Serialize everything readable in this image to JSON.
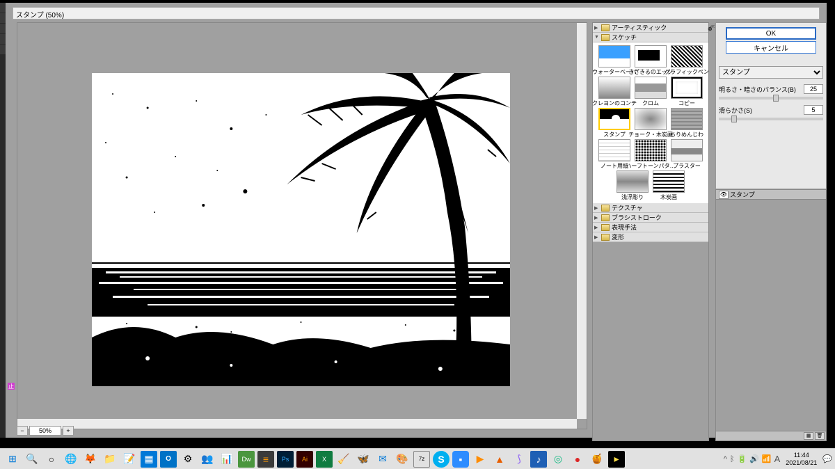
{
  "dialog": {
    "title": "スタンプ (50%)"
  },
  "zoom": {
    "minus": "−",
    "plus": "+",
    "value": "50%"
  },
  "buttons": {
    "ok": "OK",
    "cancel": "キャンセル"
  },
  "filter_select": "スタンプ",
  "sliders": {
    "balance": {
      "label": "明るさ・暗さのバランス(B)",
      "value": "25",
      "pos": 52
    },
    "smooth": {
      "label": "滑らかさ(S)",
      "value": "5",
      "pos": 12
    }
  },
  "categories": {
    "artistic": "アーティスティック",
    "sketch": "スケッチ",
    "texture": "テクスチャ",
    "brush": "ブラシストローク",
    "express": "表現手法",
    "distort": "変形"
  },
  "thumbs": [
    {
      "label": "ウォーターベーパ",
      "cls": "t-sky"
    },
    {
      "label": "きざきるのエッジ",
      "cls": "t-bw1"
    },
    {
      "label": "グラフィックペン",
      "cls": "t-lines"
    },
    {
      "label": "クレヨンのコンテ",
      "cls": "t-grad"
    },
    {
      "label": "クロム",
      "cls": "t-wave"
    },
    {
      "label": "コピー",
      "cls": "t-edge"
    },
    {
      "label": "スタンプ",
      "cls": "t-stamp",
      "selected": true
    },
    {
      "label": "チョーク・木炭画",
      "cls": "t-chalk"
    },
    {
      "label": "ちりめんじわ",
      "cls": "t-wrinkle"
    },
    {
      "label": "ノート用紙",
      "cls": "t-note"
    },
    {
      "label": "ハーフトーンパタ…",
      "cls": "t-half"
    },
    {
      "label": "プラスター",
      "cls": "t-plaster"
    },
    {
      "label": "浅浮彫り",
      "cls": "t-relief"
    },
    {
      "label": "木炭画",
      "cls": "t-wood"
    }
  ],
  "layer": {
    "name": "スタンプ"
  },
  "ime": "止",
  "system": {
    "time": "11:44",
    "date": "2021/08/21"
  }
}
